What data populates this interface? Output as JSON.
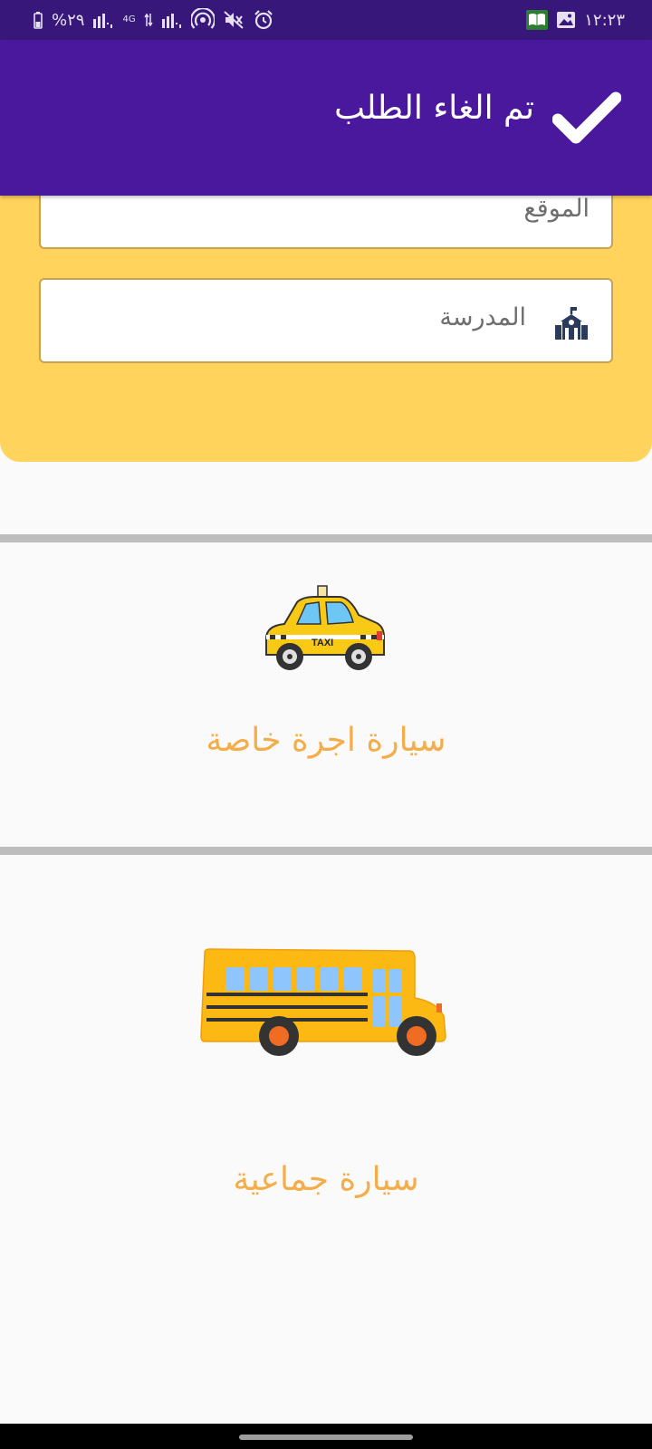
{
  "status_bar": {
    "time": "١٢:٢٣",
    "battery": "%٢٩",
    "network": "4G",
    "icons_left": [
      "battery-icon",
      "signal-icon",
      "data-arrows-icon",
      "signal-icon",
      "hotspot-icon",
      "mute-icon",
      "alarm-icon"
    ],
    "icons_right": [
      "book-app-icon",
      "image-icon"
    ]
  },
  "toast": {
    "message": "تم الغاء الطلب",
    "icon": "checkmark-icon",
    "background": "#4a189d"
  },
  "form": {
    "location_label": "الموقع",
    "school_label": "المدرسة",
    "school_icon": "school-icon",
    "panel_color": "#ffd35c"
  },
  "options": [
    {
      "label": "سيارة اجرة خاصة",
      "icon": "taxi-icon"
    },
    {
      "label": "سيارة جماعية",
      "icon": "school-bus-icon"
    }
  ],
  "colors": {
    "accent_text": "#f5ad4a",
    "status_bar": "#371779"
  }
}
